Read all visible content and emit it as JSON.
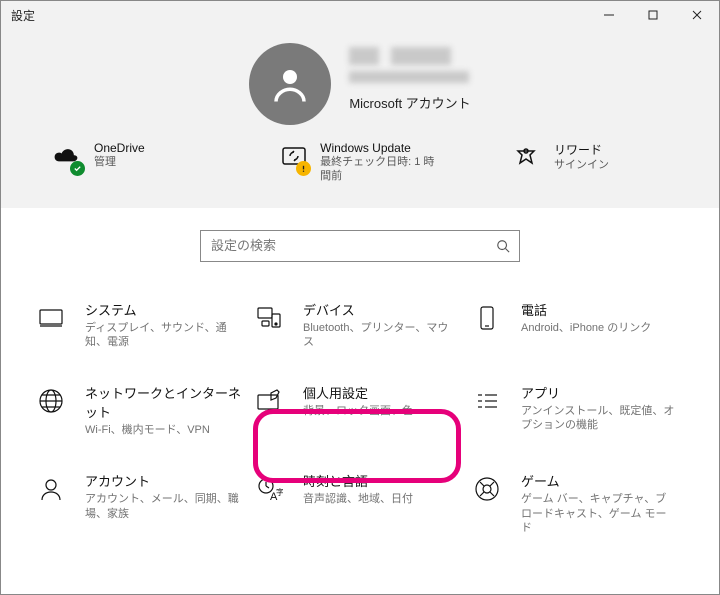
{
  "window": {
    "title": "設定"
  },
  "account": {
    "name_obscured": true,
    "email_obscured": true,
    "type": "Microsoft アカウント"
  },
  "stats": [
    {
      "id": "onedrive",
      "title": "OneDrive",
      "sub": "管理",
      "badge": "green"
    },
    {
      "id": "update",
      "title": "Windows Update",
      "sub": "最終チェック日時: 1 時間前",
      "badge": "yellow"
    },
    {
      "id": "rewards",
      "title": "リワード",
      "sub": "サインイン",
      "badge": "none"
    }
  ],
  "search": {
    "placeholder": "設定の検索"
  },
  "categories": [
    {
      "id": "system",
      "title": "システム",
      "sub": "ディスプレイ、サウンド、通知、電源"
    },
    {
      "id": "devices",
      "title": "デバイス",
      "sub": "Bluetooth、プリンター、マウス"
    },
    {
      "id": "phone",
      "title": "電話",
      "sub": "Android、iPhone のリンク"
    },
    {
      "id": "network",
      "title": "ネットワークとインターネット",
      "sub": "Wi-Fi、機内モード、VPN"
    },
    {
      "id": "personalization",
      "title": "個人用設定",
      "sub": "背景、ロック画面、色"
    },
    {
      "id": "apps",
      "title": "アプリ",
      "sub": "アンインストール、既定値、オプションの機能"
    },
    {
      "id": "accounts",
      "title": "アカウント",
      "sub": "アカウント、メール、同期、職場、家族"
    },
    {
      "id": "time",
      "title": "時刻と言語",
      "sub": "音声認識、地域、日付"
    },
    {
      "id": "gaming",
      "title": "ゲーム",
      "sub": "ゲーム バー、キャプチャ、ブロードキャスト、ゲーム モード"
    }
  ]
}
